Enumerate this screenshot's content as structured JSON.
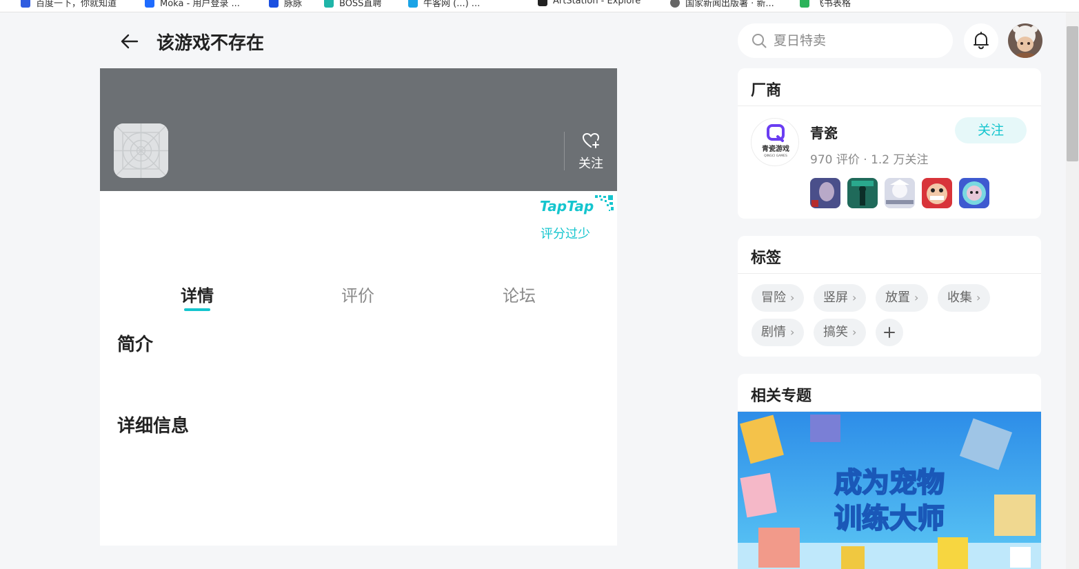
{
  "bookmarks": [
    {
      "label": "百度一下，你就知道",
      "color": "#2f5ce0"
    },
    {
      "label": "Moka - 用户登录 ...",
      "color": "#1e6bff"
    },
    {
      "label": "脉脉",
      "color": "#1a4fe0"
    },
    {
      "label": "BOSS直聘",
      "color": "#1fb5a8"
    },
    {
      "label": "牛客网 (...) ...",
      "color": "#1aa3e6"
    },
    {
      "label": "ArtStation - Explore",
      "color": "#222222"
    },
    {
      "label": "国家新闻出版署 · 新...",
      "color": "#666666"
    },
    {
      "label": "飞书表格",
      "color": "#2bb35a"
    }
  ],
  "header": {
    "title": "该游戏不存在",
    "back_icon": "arrow-left-icon"
  },
  "game": {
    "follow_label": "关注",
    "brand": "TapTap",
    "rating_status": "评分过少"
  },
  "tabs": [
    {
      "label": "详情",
      "active": true
    },
    {
      "label": "评价",
      "active": false
    },
    {
      "label": "论坛",
      "active": false
    }
  ],
  "sections": {
    "intro": "简介",
    "details": "详细信息"
  },
  "search": {
    "placeholder": "夏日特卖"
  },
  "vendor": {
    "heading": "厂商",
    "name": "青瓷",
    "stats": "970 评价 · 1.2 万关注",
    "follow_label": "关注",
    "logo_text": "青瓷游戏",
    "logo_sub": "QINGCI GAMES",
    "game_colors": [
      "#4a4f8a",
      "#1f6a5a",
      "#d8dbe8",
      "#d8343a",
      "#3e5ad0"
    ]
  },
  "tags": {
    "heading": "标签",
    "items": [
      "冒险",
      "竖屏",
      "放置",
      "收集",
      "剧情",
      "搞笑"
    ],
    "add_icon": "plus-icon"
  },
  "topics": {
    "heading": "相关专题",
    "banner_line1": "成为宠物",
    "banner_line2": "训练大师"
  },
  "colors": {
    "accent": "#15c5ce",
    "banner": "#6c7074"
  }
}
